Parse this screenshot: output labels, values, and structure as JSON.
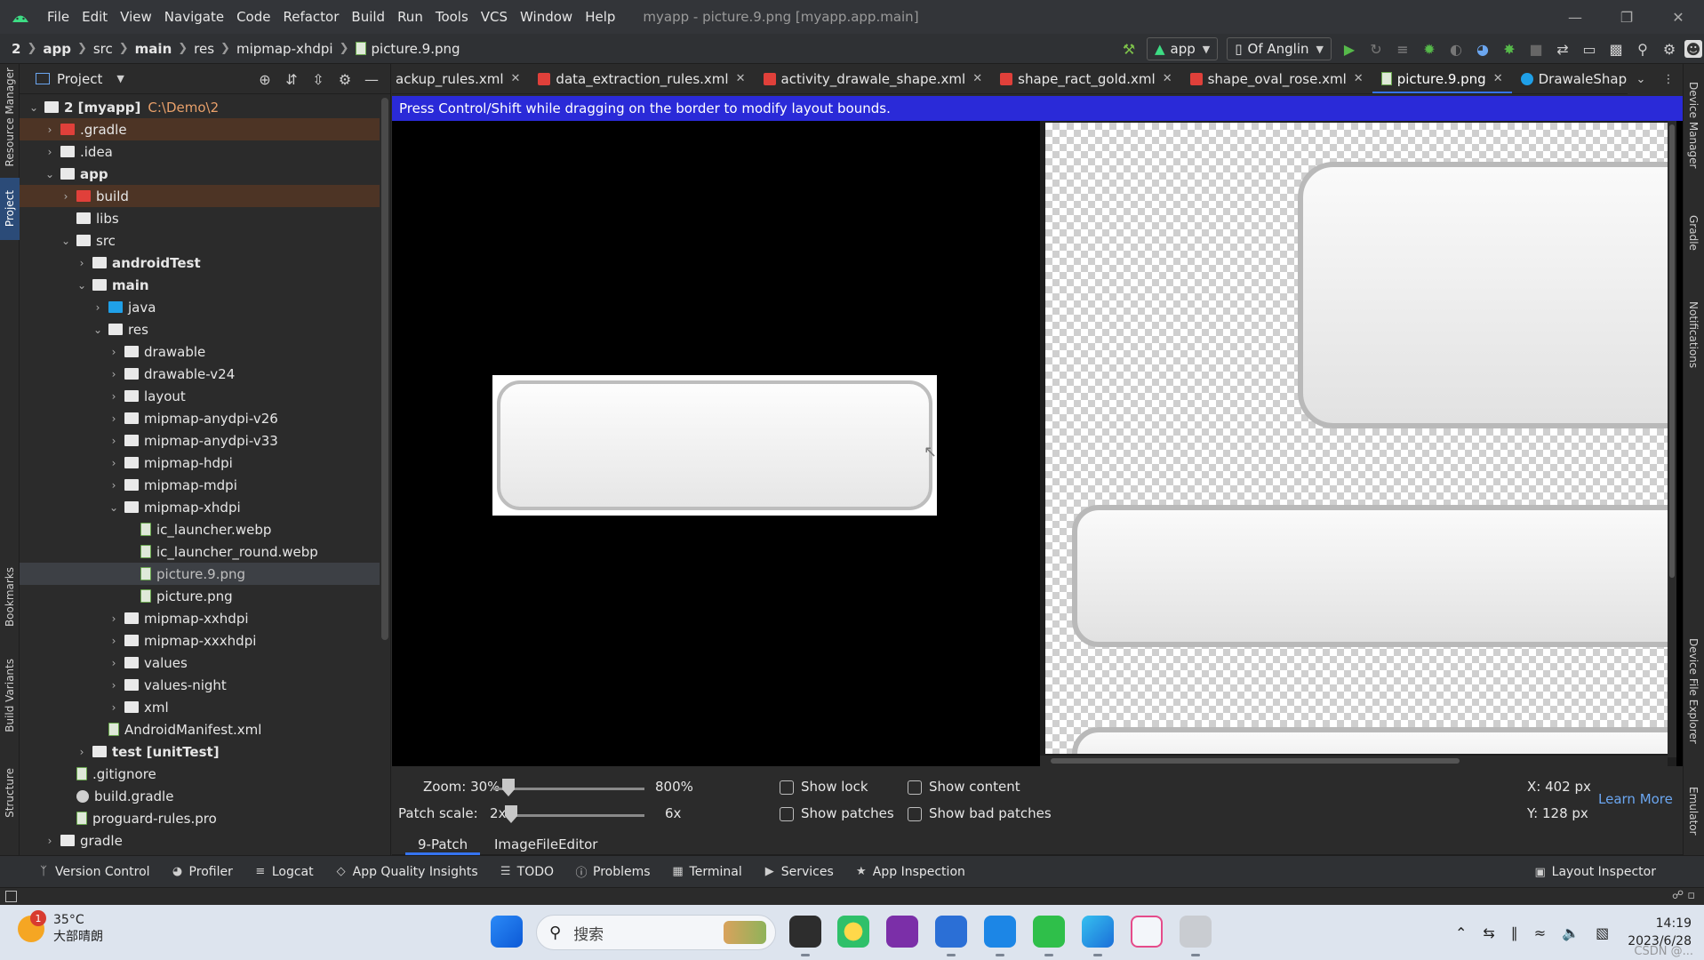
{
  "titlebar": {
    "menu": [
      "File",
      "Edit",
      "View",
      "Navigate",
      "Code",
      "Refactor",
      "Build",
      "Run",
      "Tools",
      "VCS",
      "Window",
      "Help"
    ],
    "window_title": "myapp - picture.9.png [myapp.app.main]"
  },
  "breadcrumb": [
    "2",
    "app",
    "src",
    "main",
    "res",
    "mipmap-xhdpi",
    "picture.9.png"
  ],
  "toolbar": {
    "run_config": "app",
    "device": "Of Anglin"
  },
  "left_stripe": [
    "Resource Manager",
    "Project",
    "Bookmarks",
    "Build Variants",
    "Structure"
  ],
  "right_stripe": [
    "Device Manager",
    "Gradle",
    "Notifications",
    "Device File Explorer",
    "Emulator"
  ],
  "project_panel": {
    "title": "Project",
    "tree": [
      {
        "label": "2 [myapp]",
        "path": "C:\\Demo\\2",
        "icon": "module-folder",
        "expanded": true
      },
      {
        "label": ".gradle",
        "icon": "excluded-folder",
        "expanded": false
      },
      {
        "label": ".idea",
        "icon": "folder",
        "expanded": false
      },
      {
        "label": "app",
        "icon": "module-folder",
        "expanded": true
      },
      {
        "label": "build",
        "icon": "excluded-folder",
        "expanded": false
      },
      {
        "label": "libs",
        "icon": "folder"
      },
      {
        "label": "src",
        "icon": "folder",
        "expanded": true
      },
      {
        "label": "androidTest",
        "icon": "source-folder",
        "expanded": false
      },
      {
        "label": "main",
        "icon": "source-folder",
        "expanded": true
      },
      {
        "label": "java",
        "icon": "java-folder",
        "expanded": false
      },
      {
        "label": "res",
        "icon": "res-folder",
        "expanded": true
      },
      {
        "label": "drawable",
        "icon": "folder",
        "expanded": false
      },
      {
        "label": "drawable-v24",
        "icon": "folder",
        "expanded": false
      },
      {
        "label": "layout",
        "icon": "folder",
        "expanded": false
      },
      {
        "label": "mipmap-anydpi-v26",
        "icon": "folder",
        "expanded": false
      },
      {
        "label": "mipmap-anydpi-v33",
        "icon": "folder",
        "expanded": false
      },
      {
        "label": "mipmap-hdpi",
        "icon": "folder",
        "expanded": false
      },
      {
        "label": "mipmap-mdpi",
        "icon": "folder",
        "expanded": false
      },
      {
        "label": "mipmap-xhdpi",
        "icon": "folder",
        "expanded": true
      },
      {
        "label": "ic_launcher.webp",
        "icon": "image-file"
      },
      {
        "label": "ic_launcher_round.webp",
        "icon": "image-file"
      },
      {
        "label": "picture.9.png",
        "icon": "image-file",
        "selected": true
      },
      {
        "label": "picture.png",
        "icon": "image-file"
      },
      {
        "label": "mipmap-xxhdpi",
        "icon": "folder",
        "expanded": false
      },
      {
        "label": "mipmap-xxxhdpi",
        "icon": "folder",
        "expanded": false
      },
      {
        "label": "values",
        "icon": "folder",
        "expanded": false
      },
      {
        "label": "values-night",
        "icon": "folder",
        "expanded": false
      },
      {
        "label": "xml",
        "icon": "folder",
        "expanded": false
      },
      {
        "label": "AndroidManifest.xml",
        "icon": "manifest-file"
      },
      {
        "label": "test [unitTest]",
        "icon": "source-folder",
        "expanded": false
      },
      {
        "label": ".gitignore",
        "icon": "text-file"
      },
      {
        "label": "build.gradle",
        "icon": "gradle-file"
      },
      {
        "label": "proguard-rules.pro",
        "icon": "text-file"
      },
      {
        "label": "gradle",
        "icon": "folder",
        "expanded": false
      }
    ]
  },
  "editor_tabs": [
    {
      "label": "ackup_rules.xml",
      "icon": "xml-file"
    },
    {
      "label": "data_extraction_rules.xml",
      "icon": "xml-file"
    },
    {
      "label": "activity_drawale_shape.xml",
      "icon": "xml-file"
    },
    {
      "label": "shape_ract_gold.xml",
      "icon": "xml-file"
    },
    {
      "label": "shape_oval_rose.xml",
      "icon": "xml-file"
    },
    {
      "label": "picture.9.png",
      "icon": "image-file",
      "active": true
    },
    {
      "label": "DrawaleShape",
      "icon": "class-file"
    }
  ],
  "banner": "Press Control/Shift while dragging on the border to modify layout bounds.",
  "ninepatch": {
    "zoom_label": "Zoom: 30%",
    "zoom_max": "800%",
    "zoom_fraction": 0.0,
    "patch_scale_label": "Patch scale:",
    "patch_scale_value": "2x",
    "patch_scale_max": "6x",
    "patch_scale_fraction": 0.0,
    "checkboxes": [
      {
        "label": "Show lock",
        "checked": false
      },
      {
        "label": "Show content",
        "checked": false
      },
      {
        "label": "Show patches",
        "checked": false
      },
      {
        "label": "Show bad patches",
        "checked": false
      }
    ],
    "x_readout": "X: 402 px",
    "y_readout": "Y: 128 px",
    "learn_more": "Learn More",
    "tabs": [
      "9-Patch",
      "ImageFileEditor"
    ]
  },
  "tool_windows": [
    {
      "label": "Version Control",
      "icon": "branch-icon"
    },
    {
      "label": "Profiler",
      "icon": "gauge-icon"
    },
    {
      "label": "Logcat",
      "icon": "lines-icon"
    },
    {
      "label": "App Quality Insights",
      "icon": "diamond-icon"
    },
    {
      "label": "TODO",
      "icon": "list-icon"
    },
    {
      "label": "Problems",
      "icon": "alert-icon"
    },
    {
      "label": "Terminal",
      "icon": "terminal-icon"
    },
    {
      "label": "Services",
      "icon": "play-circle-icon"
    },
    {
      "label": "App Inspection",
      "icon": "bug-icon"
    }
  ],
  "layout_inspector": "Layout Inspector",
  "taskbar": {
    "weather_temp": "35°C",
    "weather_desc": "大部晴朗",
    "weather_badge": "1",
    "search_placeholder": "搜索",
    "time": "14:19",
    "date": "2023/6/28",
    "watermark": "CSDN @..."
  },
  "colors": {
    "accent": "#3574f0",
    "banner_bg": "#2a2ad8",
    "excluded_bg": "#4d3425",
    "ide_bg": "#2b2b2b"
  }
}
